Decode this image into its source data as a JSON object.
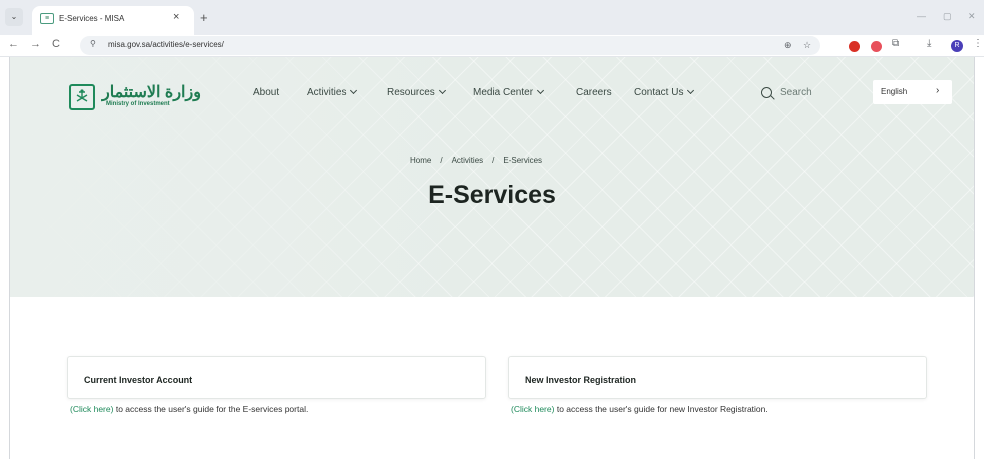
{
  "browser": {
    "tab_title": "E-Services - MISA",
    "favicon_glyph": "≡",
    "close_glyph": "×",
    "new_tab_glyph": "+",
    "menu_glyph": "⌄",
    "url": "misa.gov.sa/activities/e-services/",
    "back_glyph": "←",
    "forward_glyph": "→",
    "reload_glyph": "C",
    "site_info_glyph": "⚲",
    "zoom_glyph": "⊕",
    "star_glyph": "☆",
    "download_glyph": "⤓",
    "menu_dots_glyph": "⋮",
    "profile_initial": "R",
    "minimize_glyph": "—",
    "maximize_glyph": "▢",
    "window_close_glyph": "✕",
    "extension_colors": [
      "#d93025",
      "#e8505b"
    ],
    "profile_color": "#4a3fb8"
  },
  "header": {
    "logo_arabic": "وزارة الاستثمار",
    "logo_english": "Ministry of Investment",
    "nav": {
      "about": "About",
      "activities": "Activities",
      "resources": "Resources",
      "media_center": "Media Center",
      "careers": "Careers",
      "contact_us": "Contact Us"
    },
    "search_label": "Search",
    "language_label": "English",
    "language_arrow": "›"
  },
  "breadcrumb": {
    "home": "Home",
    "activities": "Activities",
    "current": "E-Services",
    "separator": "/"
  },
  "page_title": "E-Services",
  "cards": [
    {
      "title": "Current Investor Account",
      "link_text": "(Click here)",
      "description": "to access the user's guide for the E-services portal."
    },
    {
      "title": "New Investor Registration",
      "link_text": "(Click here)",
      "description": "to access the user's guide for new Investor Registration."
    }
  ],
  "colors": {
    "brand_green": "#1f8a5b",
    "hero_background": "#e6ede9"
  }
}
